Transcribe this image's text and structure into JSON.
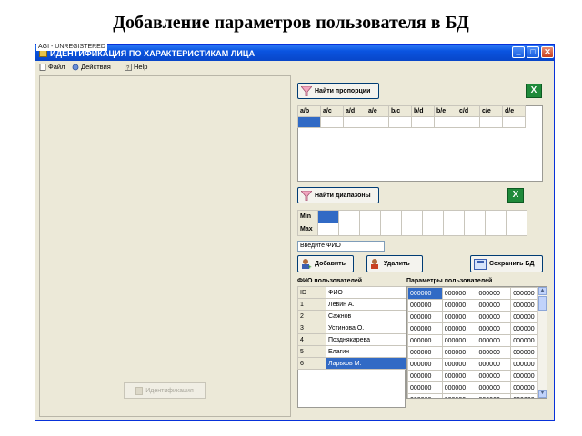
{
  "slide_title": "Добавление параметров пользователя в БД",
  "window": {
    "watermark": "AGI - UNREGISTERED",
    "title": "ИДЕНТИФИКАЦИЯ ПО ХАРАКТЕРИСТИКАМ ЛИЦА",
    "minimize": "_",
    "maximize": "□",
    "close": "✕"
  },
  "menu": [
    {
      "label": "Файл",
      "icon": "file-icon"
    },
    {
      "label": "Действия",
      "icon": "actions-icon"
    },
    {
      "label": "Help",
      "icon": "help-icon"
    }
  ],
  "left_panel": {
    "identify_button": "Идентификация"
  },
  "proportions": {
    "button": "Найти пропорции",
    "headers": [
      "a/b",
      "a/c",
      "a/d",
      "a/e",
      "b/c",
      "b/d",
      "b/e",
      "c/d",
      "c/e",
      "d/e"
    ]
  },
  "ranges": {
    "button": "Найти диапазоны",
    "rows": [
      "Min",
      "Max"
    ]
  },
  "fio": {
    "placeholder": "Введите ФИО"
  },
  "actions": {
    "add": "Добавить",
    "delete": "Удалить",
    "save": "Сохранить БД"
  },
  "users": {
    "label": "ФИО пользователей",
    "headers": [
      "ID",
      "ФИО"
    ],
    "rows": [
      {
        "id": "1",
        "name": "Левин А."
      },
      {
        "id": "2",
        "name": "Сажнов"
      },
      {
        "id": "3",
        "name": "Устинова О."
      },
      {
        "id": "4",
        "name": "Позднякарева"
      },
      {
        "id": "5",
        "name": "Елагин"
      },
      {
        "id": "6",
        "name": "Ларьков М."
      }
    ],
    "selected_index": 5
  },
  "params": {
    "label": "Параметры пользователей",
    "value": "000000",
    "rows": 10,
    "cols": 4
  },
  "colors": {
    "selection": "#316ac5",
    "titlebar": "#0a54e0",
    "excel": "#1f8a3a"
  }
}
